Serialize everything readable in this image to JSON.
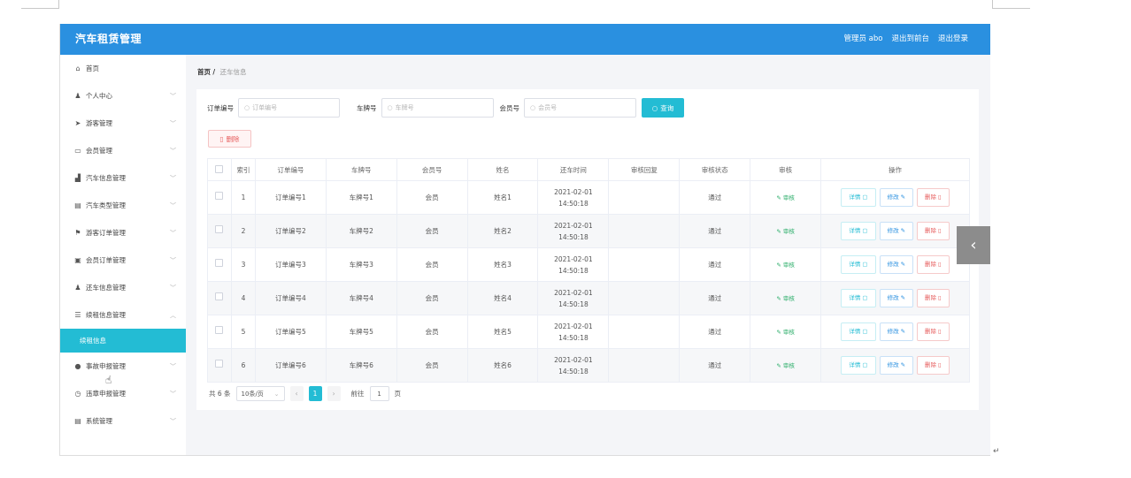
{
  "app": {
    "title": "汽车租赁管理"
  },
  "topbar": {
    "user": "管理员 abo",
    "back_front": "退出到前台",
    "logout": "退出登录"
  },
  "sidebar": {
    "items": [
      {
        "label": "首页",
        "icon": "home-icon",
        "glyph": "⌂",
        "has_children": false
      },
      {
        "label": "个人中心",
        "icon": "user-icon",
        "glyph": "♟",
        "has_children": true
      },
      {
        "label": "游客管理",
        "icon": "send-icon",
        "glyph": "➤",
        "has_children": true
      },
      {
        "label": "会员管理",
        "icon": "card-icon",
        "glyph": "▭",
        "has_children": true
      },
      {
        "label": "汽车信息管理",
        "icon": "chart-icon",
        "glyph": "▟",
        "has_children": true
      },
      {
        "label": "汽车类型管理",
        "icon": "book-icon",
        "glyph": "▤",
        "has_children": true
      },
      {
        "label": "游客订单管理",
        "icon": "flag-icon",
        "glyph": "⚑",
        "has_children": true
      },
      {
        "label": "会员订单管理",
        "icon": "archive-icon",
        "glyph": "▣",
        "has_children": true
      },
      {
        "label": "还车信息管理",
        "icon": "person-icon",
        "glyph": "♟",
        "has_children": true
      },
      {
        "label": "续租信息管理",
        "icon": "list-icon",
        "glyph": "☰",
        "has_children": true,
        "expanded": true
      },
      {
        "label": "事故申报管理",
        "icon": "location-icon",
        "glyph": "●",
        "has_children": true
      },
      {
        "label": "违章申报管理",
        "icon": "clock-icon",
        "glyph": "◷",
        "has_children": true
      },
      {
        "label": "系统管理",
        "icon": "system-icon",
        "glyph": "▤",
        "has_children": true
      }
    ],
    "active_sub": "续租信息"
  },
  "breadcrumb": {
    "home": "首页",
    "sep": "/",
    "current": "还车信息"
  },
  "search": {
    "order_label": "订单编号",
    "order_placeholder": "订单编号",
    "plate_label": "车牌号",
    "plate_placeholder": "车牌号",
    "member_label": "会员号",
    "member_placeholder": "会员号",
    "query_button": "查询"
  },
  "actions": {
    "delete_button": "删除"
  },
  "table": {
    "headers": [
      "索引",
      "订单编号",
      "车牌号",
      "会员号",
      "姓名",
      "还车时间",
      "审核回复",
      "审核状态",
      "审核",
      "操作"
    ],
    "rows": [
      {
        "index": "1",
        "order": "订单编号1",
        "plate": "车牌号1",
        "member": "会员",
        "name": "姓名1",
        "time": "2021-02-01 14:50:18",
        "reply": "",
        "status": "通过",
        "audit": "审核"
      },
      {
        "index": "2",
        "order": "订单编号2",
        "plate": "车牌号2",
        "member": "会员",
        "name": "姓名2",
        "time": "2021-02-01 14:50:18",
        "reply": "",
        "status": "通过",
        "audit": "审核"
      },
      {
        "index": "3",
        "order": "订单编号3",
        "plate": "车牌号3",
        "member": "会员",
        "name": "姓名3",
        "time": "2021-02-01 14:50:18",
        "reply": "",
        "status": "通过",
        "audit": "审核"
      },
      {
        "index": "4",
        "order": "订单编号4",
        "plate": "车牌号4",
        "member": "会员",
        "name": "姓名4",
        "time": "2021-02-01 14:50:18",
        "reply": "",
        "status": "通过",
        "audit": "审核"
      },
      {
        "index": "5",
        "order": "订单编号5",
        "plate": "车牌号5",
        "member": "会员",
        "name": "姓名5",
        "time": "2021-02-01 14:50:18",
        "reply": "",
        "status": "通过",
        "audit": "审核"
      },
      {
        "index": "6",
        "order": "订单编号6",
        "plate": "车牌号6",
        "member": "会员",
        "name": "姓名6",
        "time": "2021-02-01 14:50:18",
        "reply": "",
        "status": "通过",
        "audit": "审核"
      }
    ],
    "op_detail": "详情",
    "op_edit": "修改",
    "op_delete": "删除"
  },
  "pagination": {
    "total": "共 6 条",
    "page_size": "10条/页",
    "current_page": "1",
    "goto_label": "前往",
    "goto_value": "1",
    "goto_suffix": "页"
  },
  "colors": {
    "topbar": "#2a90e0",
    "accent": "#23bcd4",
    "danger": "#e65a5a",
    "success": "#2cae6a"
  }
}
